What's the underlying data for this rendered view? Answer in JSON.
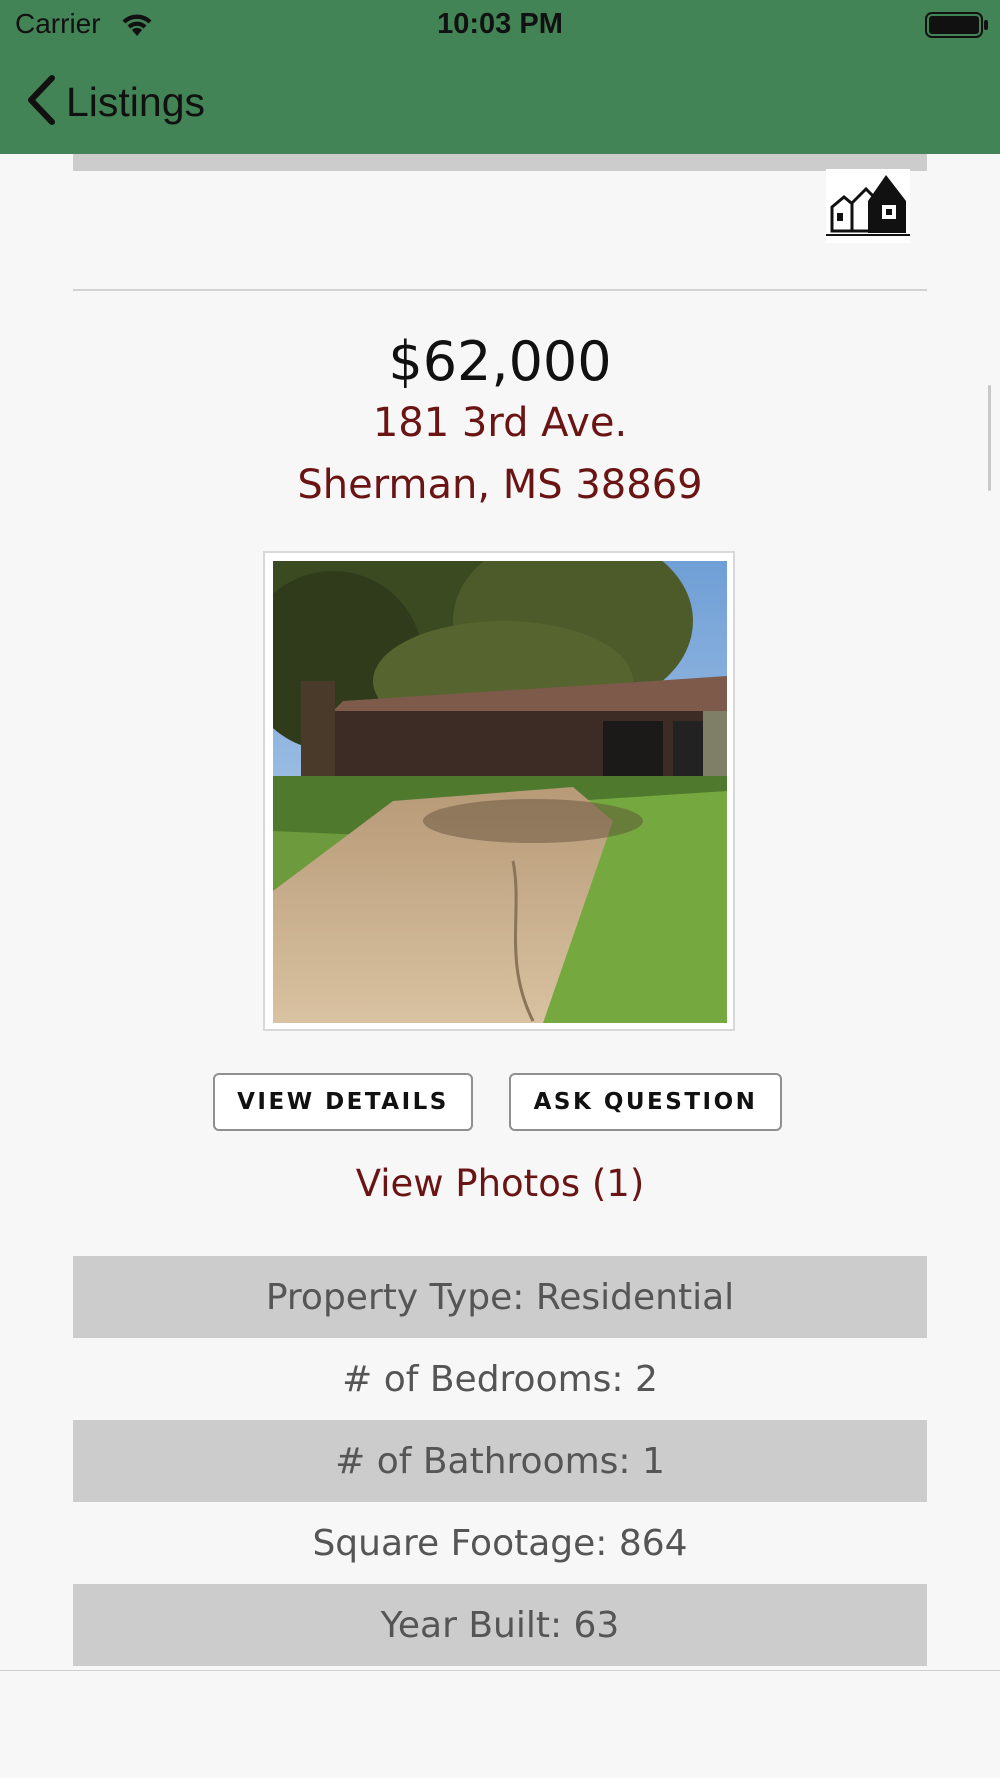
{
  "status_bar": {
    "carrier": "Carrier",
    "time": "10:03 PM"
  },
  "nav": {
    "back_label": "Listings"
  },
  "listing": {
    "price": "$62,000",
    "address_line1": "181 3rd Ave.",
    "address_line2": "Sherman, MS 38869",
    "view_details_label": "VIEW DETAILS",
    "ask_question_label": "ASK QUESTION",
    "view_photos_label": "View Photos (1)",
    "details": [
      "Property Type: Residential",
      "# of Bedrooms: 2",
      "# of Bathrooms: 1",
      "Square Footage: 864",
      "Year Built: 63"
    ]
  },
  "colors": {
    "header": "#438456",
    "address": "#6a1414",
    "row_shade": "#cccccc",
    "background": "#f7f7f7"
  },
  "icons": [
    "wifi-icon",
    "battery-icon",
    "back-chevron-icon",
    "house-logo-icon"
  ]
}
